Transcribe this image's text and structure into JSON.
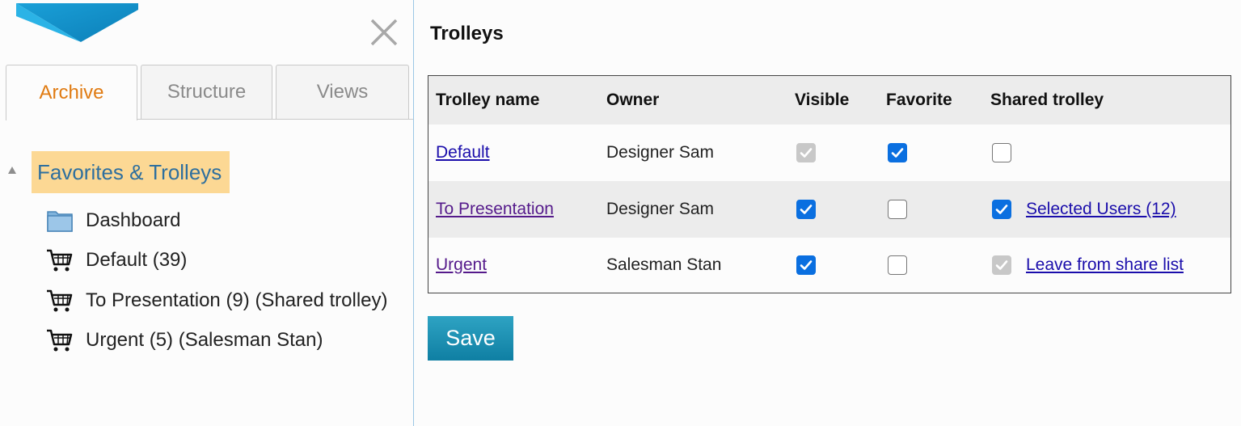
{
  "tabs": [
    {
      "label": "Archive",
      "active": true
    },
    {
      "label": "Structure",
      "active": false
    },
    {
      "label": "Views",
      "active": false
    }
  ],
  "tree": {
    "root": "Favorites & Trolleys",
    "items": [
      {
        "label": "Dashboard",
        "icon": "folder-icon"
      },
      {
        "label": "Default (39)",
        "icon": "cart-icon"
      },
      {
        "label": "To Presentation (9) (Shared trolley)",
        "icon": "cart-icon"
      },
      {
        "label": "Urgent (5) (Salesman Stan)",
        "icon": "cart-icon"
      }
    ]
  },
  "main": {
    "title": "Trolleys",
    "table": {
      "headers": [
        "Trolley name",
        "Owner",
        "Visible",
        "Favorite",
        "Shared trolley"
      ],
      "rows": [
        {
          "name": "Default",
          "owner": "Designer Sam",
          "visible": "checked-disabled",
          "favorite": "checked",
          "shared": "unchecked",
          "share_link": ""
        },
        {
          "name": "To Presentation",
          "owner": "Designer Sam",
          "visible": "checked",
          "favorite": "unchecked",
          "shared": "checked",
          "share_link": "Selected Users (12)"
        },
        {
          "name": "Urgent",
          "owner": "Salesman Stan",
          "visible": "checked",
          "favorite": "unchecked",
          "shared": "checked-disabled",
          "share_link": "Leave from share list"
        }
      ]
    },
    "save_label": "Save"
  },
  "colors": {
    "accent_orange": "#e07b12",
    "tree_highlight": "#fcd894",
    "tree_root_text": "#2e6f9e",
    "checkbox_blue": "#0a6fe0",
    "save_button": "#1890b3",
    "link": "#1a0dab"
  }
}
